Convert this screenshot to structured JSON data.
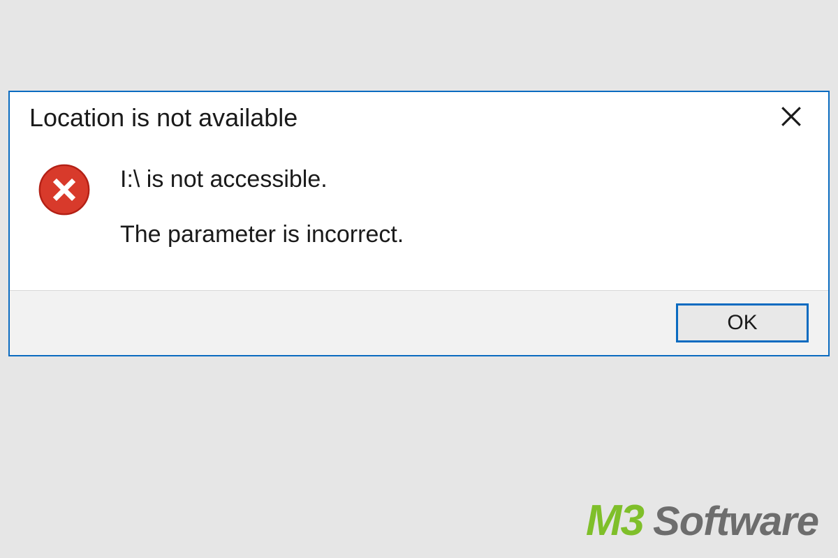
{
  "dialog": {
    "title": "Location is not available",
    "error_line1": "I:\\ is not accessible.",
    "error_line2": "The parameter is incorrect.",
    "ok_label": "OK"
  },
  "watermark": {
    "brand_prefix": "M3",
    "brand_suffix": "Software"
  },
  "icons": {
    "error": "error-circle-x",
    "close": "close-x"
  },
  "colors": {
    "dialog_border": "#0a6bc0",
    "error_red": "#d83a2b",
    "wm_green": "#7fbf2a",
    "wm_gray": "#6d6d6d"
  }
}
